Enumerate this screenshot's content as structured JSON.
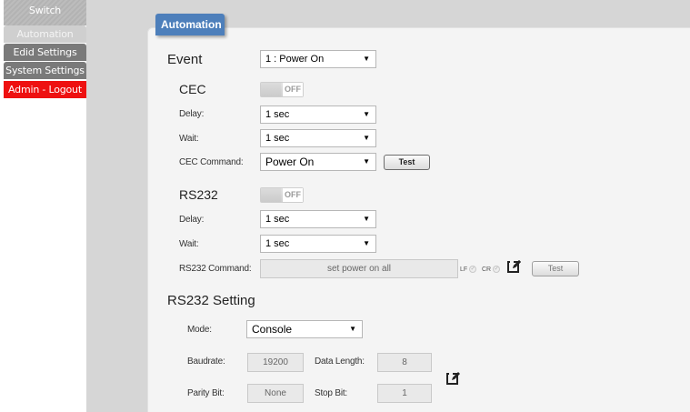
{
  "sidebar": {
    "items": [
      {
        "label": "Switch"
      },
      {
        "label": "Automation"
      },
      {
        "label": "Edid Settings"
      },
      {
        "label": "System Settings"
      },
      {
        "label": "Admin - Logout"
      }
    ]
  },
  "tab": {
    "title": "Automation"
  },
  "event": {
    "label": "Event",
    "value": "1 : Power On"
  },
  "cec": {
    "heading": "CEC",
    "toggle": "OFF",
    "delay_label": "Delay:",
    "delay_value": "1 sec",
    "wait_label": "Wait:",
    "wait_value": "1 sec",
    "command_label": "CEC Command:",
    "command_value": "Power On",
    "test_label": "Test"
  },
  "rs232": {
    "heading": "RS232",
    "toggle": "OFF",
    "delay_label": "Delay:",
    "delay_value": "1 sec",
    "wait_label": "Wait:",
    "wait_value": "1 sec",
    "command_label": "RS232 Command:",
    "command_value": "set power on all",
    "lf_label": "LF",
    "cr_label": "CR",
    "test_label": "Test"
  },
  "rs232_setting": {
    "heading": "RS232 Setting",
    "mode_label": "Mode:",
    "mode_value": "Console",
    "baudrate_label": "Baudrate:",
    "baudrate_value": "19200",
    "data_length_label": "Data Length:",
    "data_length_value": "8",
    "parity_label": "Parity Bit:",
    "parity_value": "None",
    "stop_label": "Stop Bit:",
    "stop_value": "1"
  },
  "colors": {
    "accent": "#4d7fbb",
    "logout": "#ee1111",
    "sidebar_dark": "#7a7a7a"
  }
}
